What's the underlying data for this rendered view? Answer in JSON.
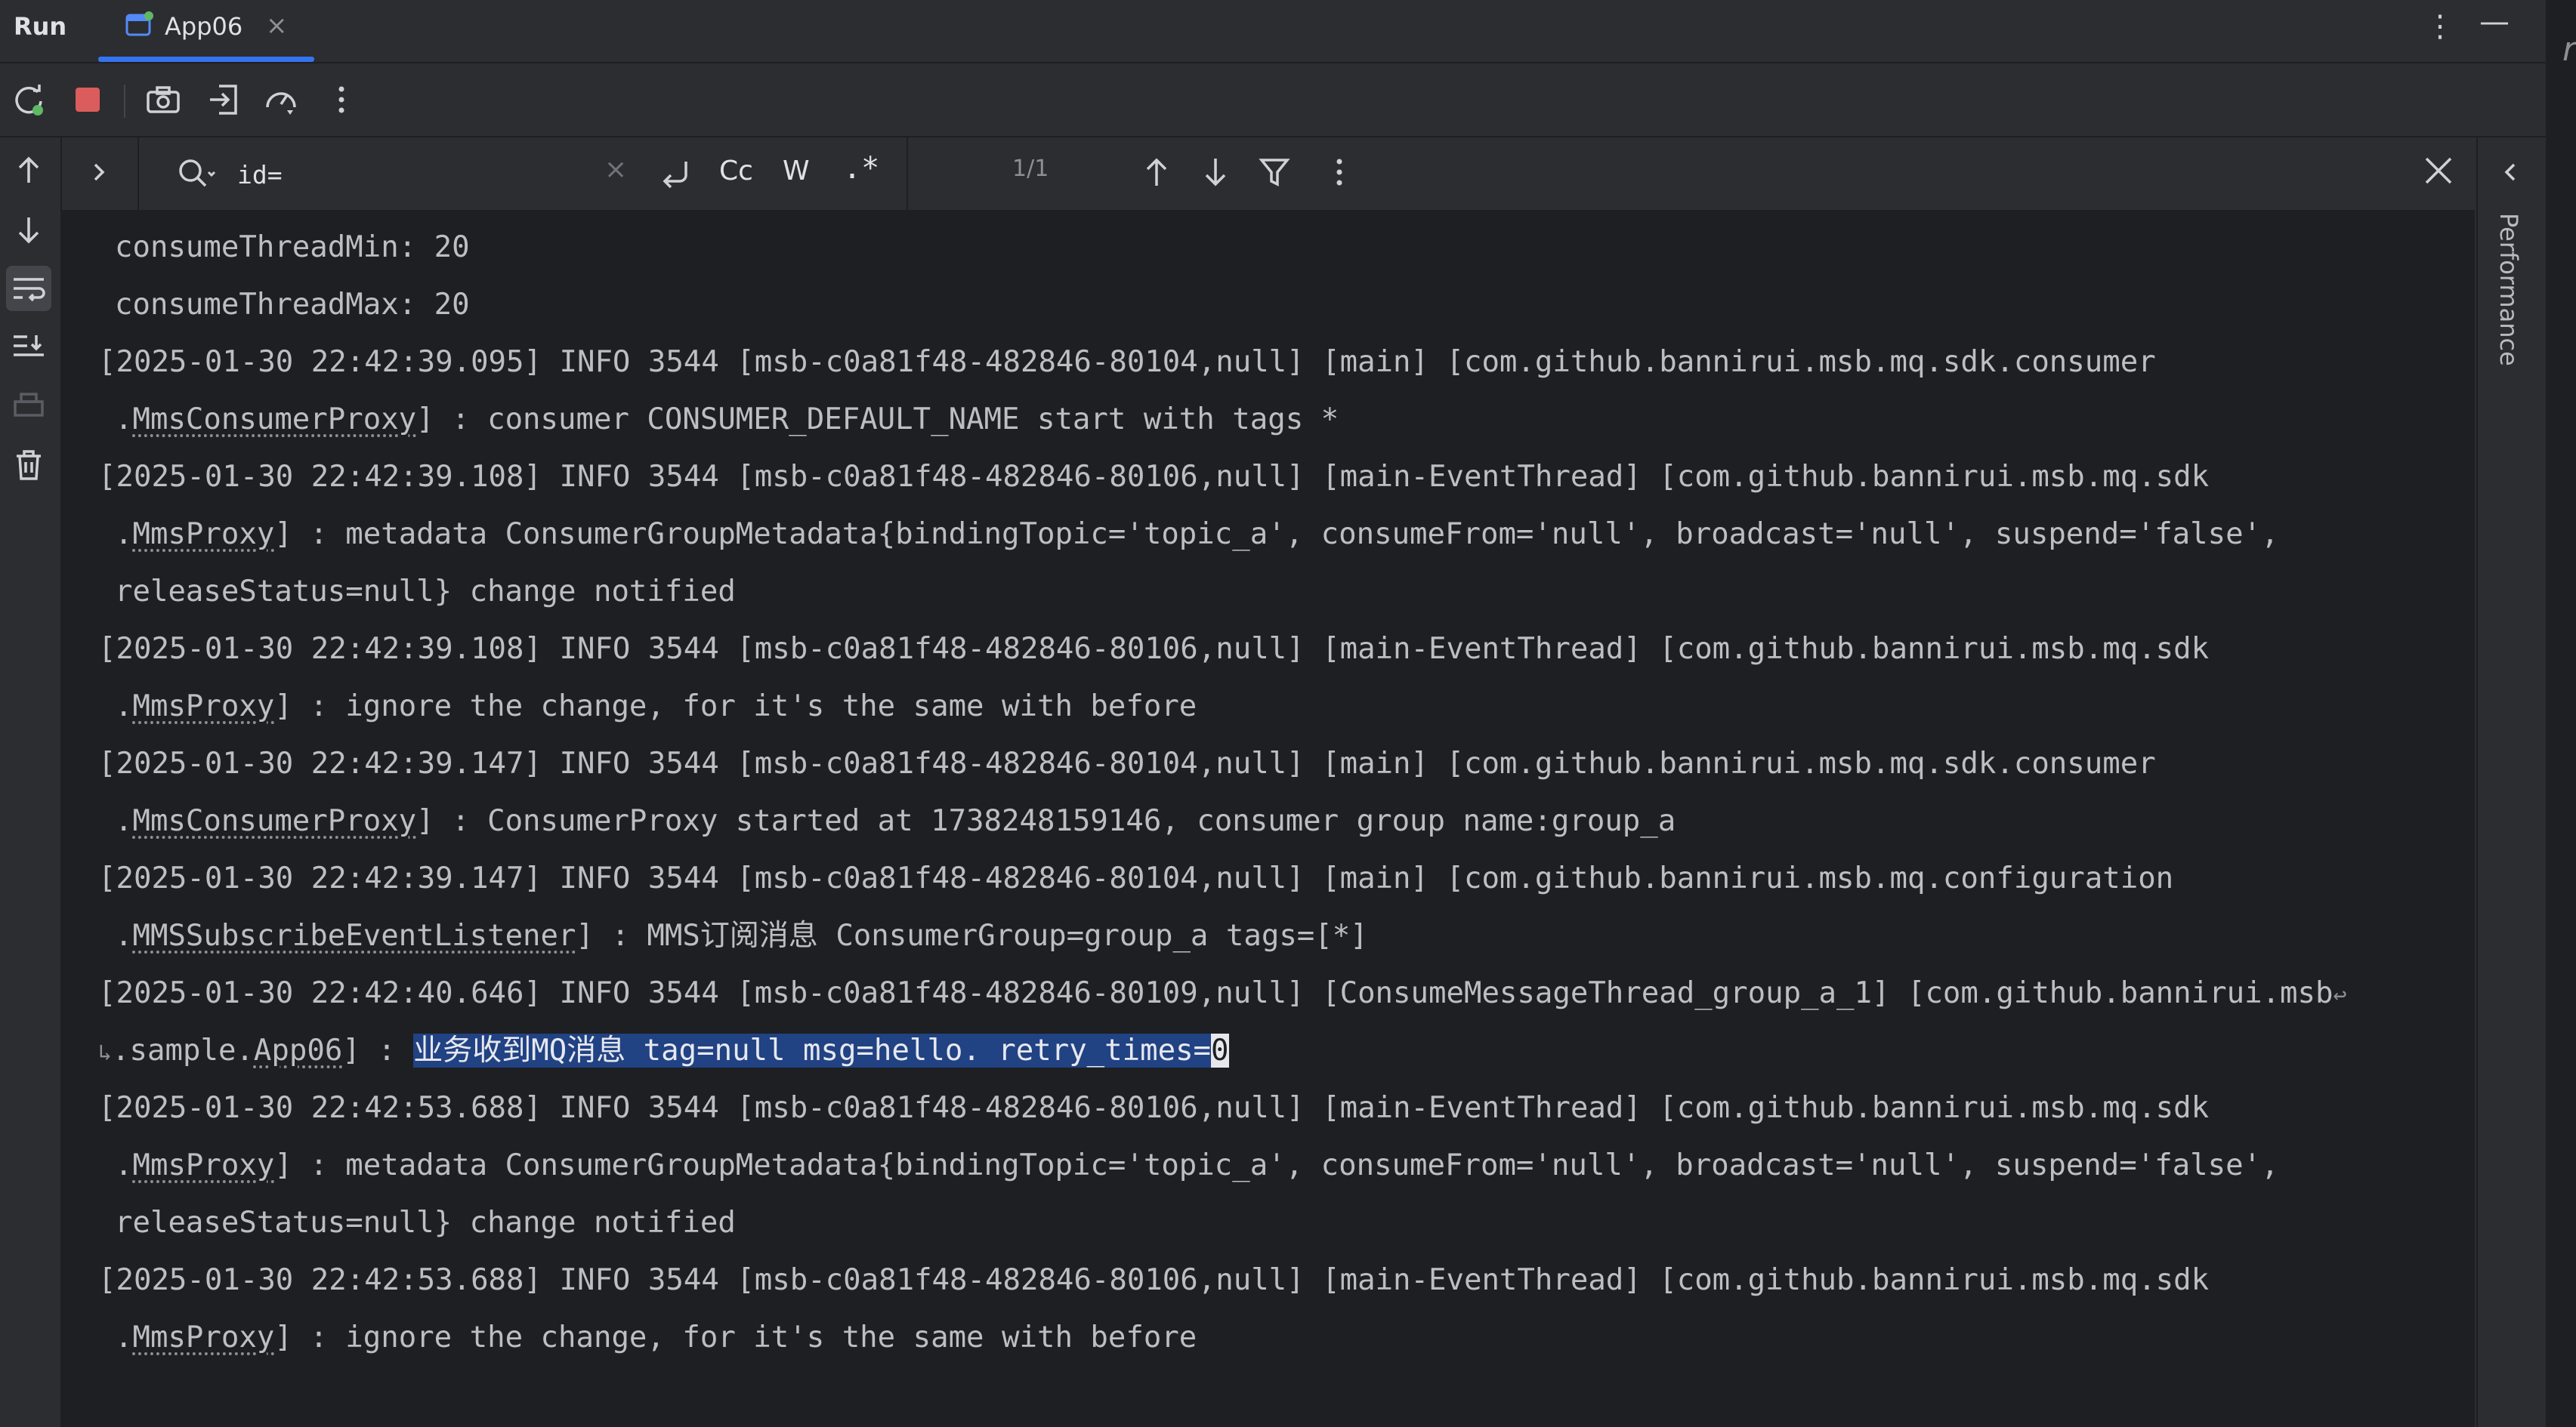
{
  "tabs": {
    "run_label": "Run",
    "active_tab": "App06",
    "close_glyph": "×"
  },
  "window": {
    "more_glyph": "⋮",
    "minimize_glyph": "—",
    "outer_glyph": "r"
  },
  "toolbar": {
    "icons": [
      "rerun-icon",
      "stop-icon",
      "camera-icon",
      "login-icon",
      "gauge-icon",
      "more-vertical-icon"
    ]
  },
  "find": {
    "query": "id=",
    "clear_glyph": "×",
    "match_case_label": "Cc",
    "whole_words_label": "W",
    "regex_label": ".*",
    "count": "1/1"
  },
  "right_panel": {
    "label": "Performance"
  },
  "console": {
    "lines": [
      {
        "indent": true,
        "segments": [
          {
            "t": "consumeThreadMin: 20"
          }
        ]
      },
      {
        "indent": true,
        "segments": [
          {
            "t": "consumeThreadMax: 20"
          }
        ]
      },
      {
        "indent": false,
        "segments": [
          {
            "t": "[2025-01-30 22:42:39.095] INFO 3544 [msb-c0a81f48-482846-80104,null] [main] [com.github.bannirui.msb.mq.sdk.consumer"
          }
        ]
      },
      {
        "indent": true,
        "segments": [
          {
            "t": "."
          },
          {
            "t": "MmsConsumerProxy",
            "cls": "u"
          },
          {
            "t": "] : consumer CONSUMER_DEFAULT_NAME start with tags *"
          }
        ]
      },
      {
        "indent": false,
        "segments": [
          {
            "t": "[2025-01-30 22:42:39.108] INFO 3544 [msb-c0a81f48-482846-80106,null] [main-EventThread] [com.github.bannirui.msb.mq.sdk"
          }
        ]
      },
      {
        "indent": true,
        "segments": [
          {
            "t": "."
          },
          {
            "t": "MmsProxy",
            "cls": "u"
          },
          {
            "t": "] : metadata ConsumerGroupMetadata{bindingTopic='topic_a', consumeFrom='null', broadcast='null', suspend='false',"
          }
        ]
      },
      {
        "indent": true,
        "segments": [
          {
            "t": "releaseStatus=null} change notified"
          }
        ]
      },
      {
        "indent": false,
        "segments": [
          {
            "t": "[2025-01-30 22:42:39.108] INFO 3544 [msb-c0a81f48-482846-80106,null] [main-EventThread] [com.github.bannirui.msb.mq.sdk"
          }
        ]
      },
      {
        "indent": true,
        "segments": [
          {
            "t": "."
          },
          {
            "t": "MmsProxy",
            "cls": "u"
          },
          {
            "t": "] : ignore the change, for it's the same with before"
          }
        ]
      },
      {
        "indent": false,
        "segments": [
          {
            "t": "[2025-01-30 22:42:39.147] INFO 3544 [msb-c0a81f48-482846-80104,null] [main] [com.github.bannirui.msb.mq.sdk.consumer"
          }
        ]
      },
      {
        "indent": true,
        "segments": [
          {
            "t": "."
          },
          {
            "t": "MmsConsumerProxy",
            "cls": "u"
          },
          {
            "t": "] : ConsumerProxy started at 1738248159146, consumer group name:group_a"
          }
        ]
      },
      {
        "indent": false,
        "segments": [
          {
            "t": "[2025-01-30 22:42:39.147] INFO 3544 [msb-c0a81f48-482846-80104,null] [main] [com.github.bannirui.msb.mq.configuration"
          }
        ]
      },
      {
        "indent": true,
        "segments": [
          {
            "t": "."
          },
          {
            "t": "MMSSubscribeEventListener",
            "cls": "u"
          },
          {
            "t": "] : MMS订阅消息 ConsumerGroup=group_a tags=[*]"
          }
        ]
      },
      {
        "indent": false,
        "segments": [
          {
            "t": "[2025-01-30 22:42:40.646] INFO 3544 [msb-c0a81f48-482846-80109,null] [ConsumeMessageThread_group_a_1] [com.github.bannirui.msb"
          },
          {
            "t": "↩",
            "cls": "wrapmark"
          }
        ]
      },
      {
        "indent": false,
        "segments": [
          {
            "t": "↳",
            "cls": "wrapmark"
          },
          {
            "t": ".sample."
          },
          {
            "t": "App06",
            "cls": "u"
          },
          {
            "t": "] : "
          },
          {
            "t": "业务收到MQ消息 tag=null msg=hello. retry_times=",
            "cls": "hl"
          },
          {
            "t": "0",
            "cls": "cursor"
          }
        ]
      },
      {
        "indent": false,
        "segments": [
          {
            "t": "[2025-01-30 22:42:53.688] INFO 3544 [msb-c0a81f48-482846-80106,null] [main-EventThread] [com.github.bannirui.msb.mq.sdk"
          }
        ]
      },
      {
        "indent": true,
        "segments": [
          {
            "t": "."
          },
          {
            "t": "MmsProxy",
            "cls": "u"
          },
          {
            "t": "] : metadata ConsumerGroupMetadata{bindingTopic='topic_a', consumeFrom='null', broadcast='null', suspend='false',"
          }
        ]
      },
      {
        "indent": true,
        "segments": [
          {
            "t": "releaseStatus=null} change notified"
          }
        ]
      },
      {
        "indent": false,
        "segments": [
          {
            "t": "[2025-01-30 22:42:53.688] INFO 3544 [msb-c0a81f48-482846-80106,null] [main-EventThread] [com.github.bannirui.msb.mq.sdk"
          }
        ]
      },
      {
        "indent": true,
        "segments": [
          {
            "t": "."
          },
          {
            "t": "MmsProxy",
            "cls": "u"
          },
          {
            "t": "] : ignore the change, for it's the same with before"
          }
        ]
      }
    ]
  },
  "colors": {
    "accent": "#3574f0",
    "stop_red": "#db5c5c",
    "selection": "#214283",
    "console_bg": "#1e1f22"
  }
}
